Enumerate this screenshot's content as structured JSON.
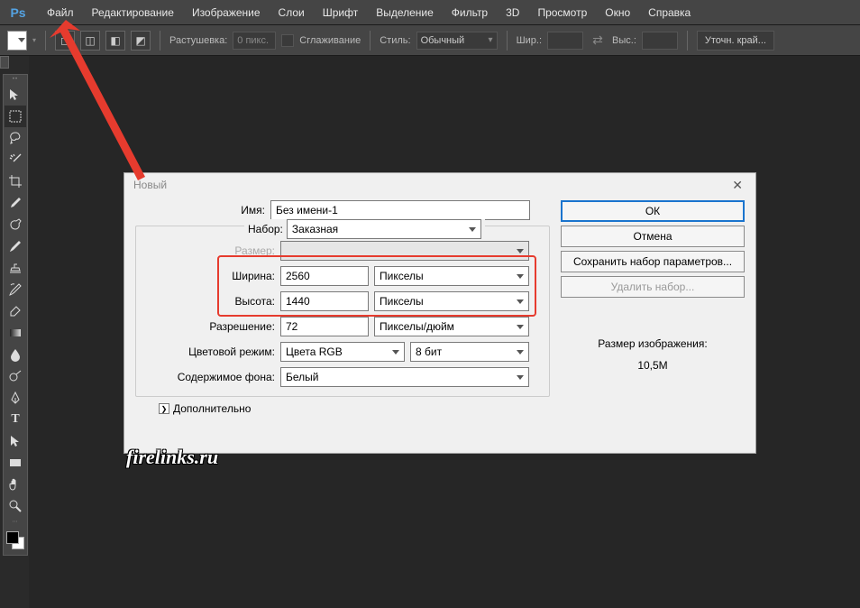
{
  "menubar": {
    "logo": "Ps",
    "items": [
      "Файл",
      "Редактирование",
      "Изображение",
      "Слои",
      "Шрифт",
      "Выделение",
      "Фильтр",
      "3D",
      "Просмотр",
      "Окно",
      "Справка"
    ]
  },
  "optionsbar": {
    "feather_label": "Растушевка:",
    "feather_value": "0 пикс.",
    "antialias_label": "Сглаживание",
    "style_label": "Стиль:",
    "style_value": "Обычный",
    "width_label": "Шир.:",
    "height_label": "Выс.:",
    "refine_label": "Уточн. край..."
  },
  "dialog": {
    "title": "Новый",
    "name_label": "Имя:",
    "name_value": "Без имени-1",
    "preset_label": "Набор:",
    "preset_value": "Заказная",
    "size_label": "Размер:",
    "width_label": "Ширина:",
    "width_value": "2560",
    "width_unit": "Пикселы",
    "height_label": "Высота:",
    "height_value": "1440",
    "height_unit": "Пикселы",
    "resolution_label": "Разрешение:",
    "resolution_value": "72",
    "resolution_unit": "Пикселы/дюйм",
    "colormode_label": "Цветовой режим:",
    "colormode_value": "Цвета RGB",
    "colordepth_value": "8 бит",
    "bg_label": "Содержимое фона:",
    "bg_value": "Белый",
    "advanced_label": "Дополнительно",
    "ok": "ОК",
    "cancel": "Отмена",
    "save_preset": "Сохранить набор параметров...",
    "delete_preset": "Удалить набор...",
    "sizeinfo_label": "Размер изображения:",
    "sizeinfo_value": "10,5M"
  },
  "watermark": "firelinks.ru"
}
